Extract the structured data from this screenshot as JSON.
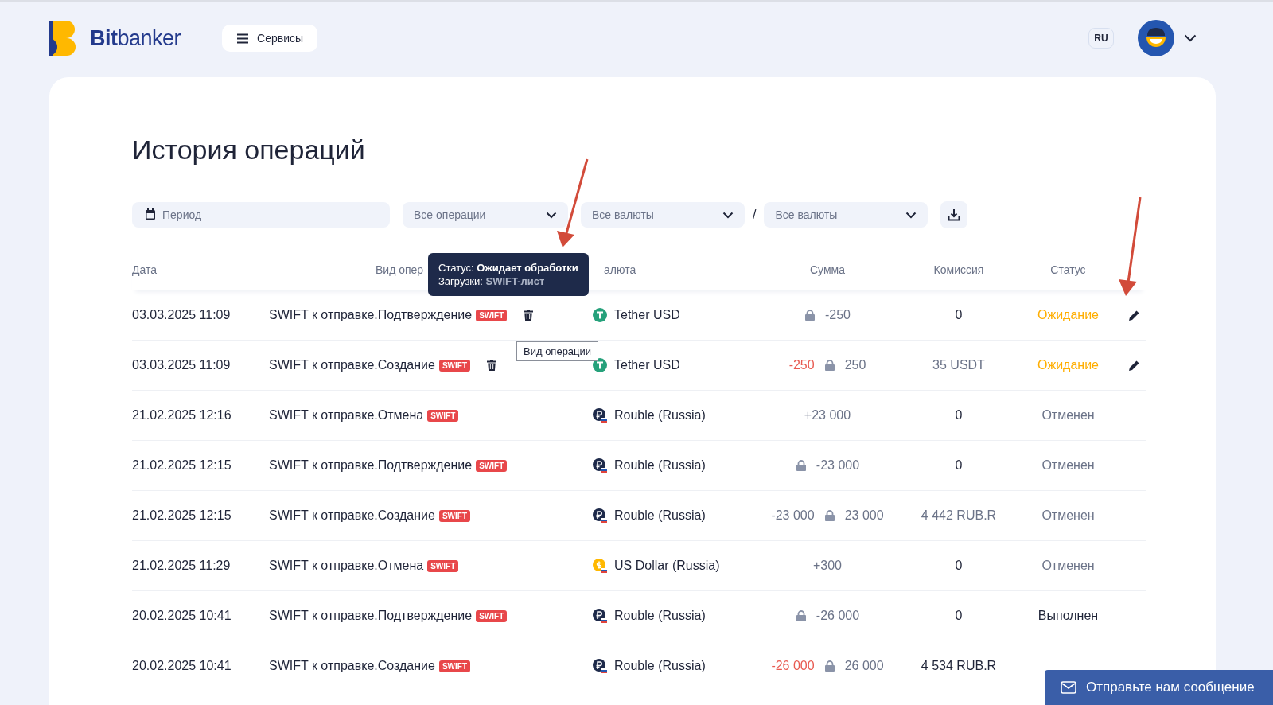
{
  "logo": {
    "bold": "Bit",
    "light": "banker"
  },
  "services_button": "Сервисы",
  "language": "RU",
  "title": "История операций",
  "filters": {
    "period": {
      "placeholder": "Период"
    },
    "selects": [
      {
        "value": "Все операции"
      },
      {
        "value": "Все валюты"
      },
      {
        "value": "Все валюты"
      }
    ],
    "separator": "/"
  },
  "table": {
    "columns": [
      "Дата",
      "Вид опер",
      "алюта",
      "Сумма",
      "Комиссия",
      "Статус"
    ],
    "rows": [
      {
        "date": "03.03.2025 11:09",
        "type": "SWIFT к отправке.Подтверждение",
        "badge": "SWIFT",
        "deletable": true,
        "currency": {
          "kind": "tether",
          "name": "Tether USD"
        },
        "amount": [
          {
            "kind": "locked",
            "text": "-250"
          }
        ],
        "fee": "0",
        "fee_muted": false,
        "status": {
          "kind": "pending",
          "label": "Ожидание"
        },
        "editable": true
      },
      {
        "date": "03.03.2025 11:09",
        "type": "SWIFT к отправке.Создание",
        "badge": "SWIFT",
        "deletable": true,
        "currency": {
          "kind": "tether",
          "name": "Tether USD"
        },
        "amount": [
          {
            "kind": "debit",
            "text": "-250"
          },
          {
            "kind": "locked",
            "text": "250"
          }
        ],
        "fee": "35 USDT",
        "fee_muted": true,
        "status": {
          "kind": "pending",
          "label": "Ожидание"
        },
        "editable": true
      },
      {
        "date": "21.02.2025 12:16",
        "type": "SWIFT к отправке.Отмена",
        "badge": "SWIFT",
        "deletable": false,
        "currency": {
          "kind": "rouble",
          "name": "Rouble (Russia)"
        },
        "amount": [
          {
            "kind": "plain",
            "text": "+23 000"
          }
        ],
        "fee": "0",
        "fee_muted": false,
        "status": {
          "kind": "cancelled",
          "label": "Отменен"
        },
        "editable": false
      },
      {
        "date": "21.02.2025 12:15",
        "type": "SWIFT к отправке.Подтверждение",
        "badge": "SWIFT",
        "deletable": false,
        "currency": {
          "kind": "rouble",
          "name": "Rouble (Russia)"
        },
        "amount": [
          {
            "kind": "locked",
            "text": "-23 000"
          }
        ],
        "fee": "0",
        "fee_muted": false,
        "status": {
          "kind": "cancelled",
          "label": "Отменен"
        },
        "editable": false
      },
      {
        "date": "21.02.2025 12:15",
        "type": "SWIFT к отправке.Создание",
        "badge": "SWIFT",
        "deletable": false,
        "currency": {
          "kind": "rouble",
          "name": "Rouble (Russia)"
        },
        "amount": [
          {
            "kind": "plain",
            "text": "-23 000"
          },
          {
            "kind": "locked",
            "text": "23 000"
          }
        ],
        "fee": "4 442 RUB.R",
        "fee_muted": true,
        "status": {
          "kind": "cancelled",
          "label": "Отменен"
        },
        "editable": false
      },
      {
        "date": "21.02.2025 11:29",
        "type": "SWIFT к отправке.Отмена",
        "badge": "SWIFT",
        "deletable": false,
        "currency": {
          "kind": "usd",
          "name": "US Dollar (Russia)"
        },
        "amount": [
          {
            "kind": "plain",
            "text": "+300"
          }
        ],
        "fee": "0",
        "fee_muted": false,
        "status": {
          "kind": "cancelled",
          "label": "Отменен"
        },
        "editable": false
      },
      {
        "date": "20.02.2025 10:41",
        "type": "SWIFT к отправке.Подтверждение",
        "badge": "SWIFT",
        "deletable": false,
        "currency": {
          "kind": "rouble",
          "name": "Rouble (Russia)"
        },
        "amount": [
          {
            "kind": "locked",
            "text": "-26 000"
          }
        ],
        "fee": "0",
        "fee_muted": false,
        "status": {
          "kind": "done",
          "label": "Выполнен"
        },
        "editable": false
      },
      {
        "date": "20.02.2025 10:41",
        "type": "SWIFT к отправке.Создание",
        "badge": "SWIFT",
        "deletable": false,
        "currency": {
          "kind": "rouble",
          "name": "Rouble (Russia)"
        },
        "amount": [
          {
            "kind": "debit",
            "text": "-26 000"
          },
          {
            "kind": "locked",
            "text": "26 000"
          }
        ],
        "fee": "4 534 RUB.R",
        "fee_muted": false,
        "editable": false
      }
    ]
  },
  "status_tooltip": [
    "Статус: **Ожидает обработки**",
    "Загрузки: **SWIFT-лист**"
  ],
  "type_tooltip": "Вид операции",
  "chat_widget": "Отправьте нам сообщение"
}
